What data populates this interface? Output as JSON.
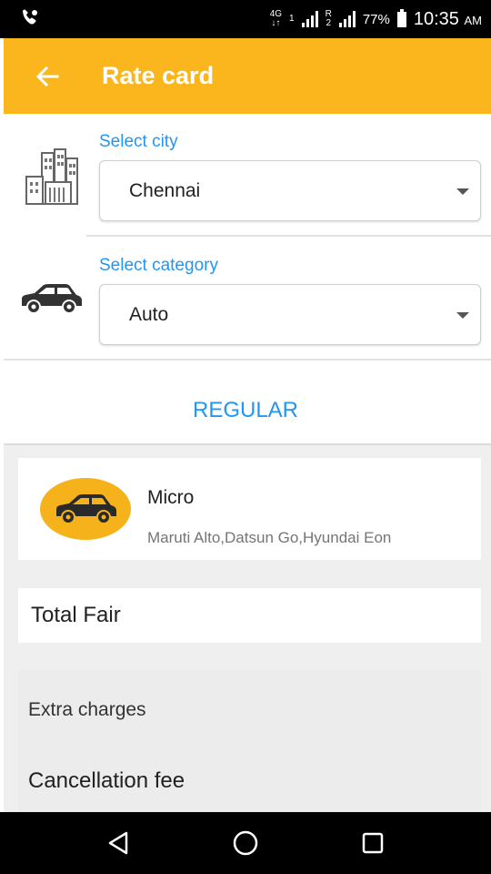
{
  "status_bar": {
    "network_1": "4G",
    "sim_1": "1",
    "network_2": "R",
    "sim_2": "2",
    "battery": "77%",
    "time": "10:35",
    "ampm": "AM"
  },
  "app_bar": {
    "title": "Rate card",
    "back_icon": "arrow-left-icon",
    "color": "#FBB61D"
  },
  "city": {
    "label": "Select city",
    "value": "Chennai",
    "icon": "city-buildings-icon"
  },
  "category": {
    "label": "Select category",
    "value": "Auto",
    "icon": "car-icon"
  },
  "tab": {
    "label": "REGULAR"
  },
  "vehicle": {
    "name": "Micro",
    "models": "Maruti Alto,Datsun Go,Hyundai Eon",
    "icon": "car-icon"
  },
  "total_fair_label": "Total Fair",
  "extra_charges_label": "Extra charges",
  "cancellation_fee_label": "Cancellation fee",
  "accent_color": "#2196F3"
}
